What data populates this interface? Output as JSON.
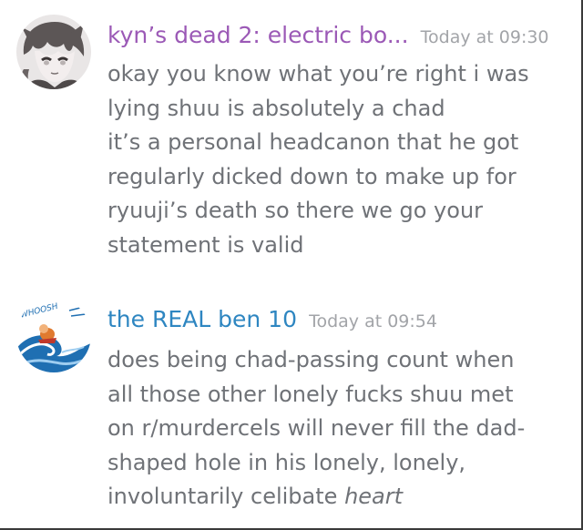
{
  "colors": {
    "username_1": "#9b59b6",
    "username_2": "#2e86c1",
    "timestamp": "#a2a4a8",
    "message_text": "#6f7277"
  },
  "messages": [
    {
      "avatar_icon": "anime-character-avatar-icon",
      "username": "kyn’s dead 2: electric bo...",
      "timestamp": "Today at 09:30",
      "lines": [
        "okay you know what you’re right i was",
        "lying shuu is absolutely a chad",
        "it’s a personal headcanon that he got",
        "regularly dicked down to make up for",
        "ryuuji’s death so there we go your",
        "statement is valid"
      ]
    },
    {
      "avatar_icon": "whoosh-wave-avatar-icon",
      "avatar_text": "WHOOSH",
      "username": "the REAL ben 10",
      "timestamp": "Today at 09:54",
      "lines": [
        "does being chad-passing count when",
        "all those other lonely fucks shuu met",
        "on r/murdercels will never fill the dad-",
        "shaped hole in his lonely, lonely,"
      ],
      "last_line_plain": "involuntarily celibate ",
      "last_line_italic": "heart"
    }
  ]
}
